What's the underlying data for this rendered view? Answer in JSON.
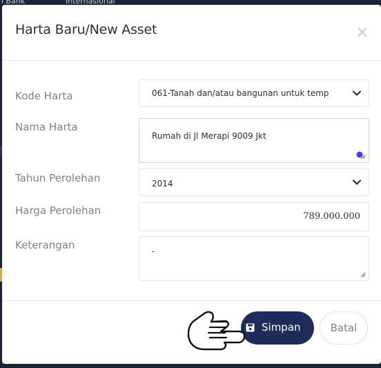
{
  "background": {
    "top_left_text": "i Bank",
    "top_right_text": "Internasional"
  },
  "modal": {
    "title": "Harta Baru/New Asset",
    "close_glyph": "×"
  },
  "form": {
    "kode_harta": {
      "label": "Kode Harta",
      "value": "061-Tanah dan/atau bangunan untuk temp"
    },
    "nama_harta": {
      "label": "Nama Harta",
      "value": "Rumah di Jl Merapi 9009 Jkt"
    },
    "tahun_perolehan": {
      "label": "Tahun Perolehan",
      "value": "2014"
    },
    "harga_perolehan": {
      "label": "Harga Perolehan",
      "value": "789.000.000"
    },
    "keterangan": {
      "label": "Keterangan",
      "value": "-"
    }
  },
  "footer": {
    "save_label": "Simpan",
    "cancel_label": "Batal"
  },
  "colors": {
    "primary": "#1f2c5a",
    "backdrop": "#1b2436",
    "accent_orange": "#e8a33c",
    "grammarly_purple": "#4b3bd8"
  },
  "icons": {
    "close": "close-icon",
    "select_chevron": "chevron-down-icon",
    "save": "save-icon",
    "resize_grip": "resize-handle-icon",
    "pointer": "pointing-hand-icon"
  }
}
